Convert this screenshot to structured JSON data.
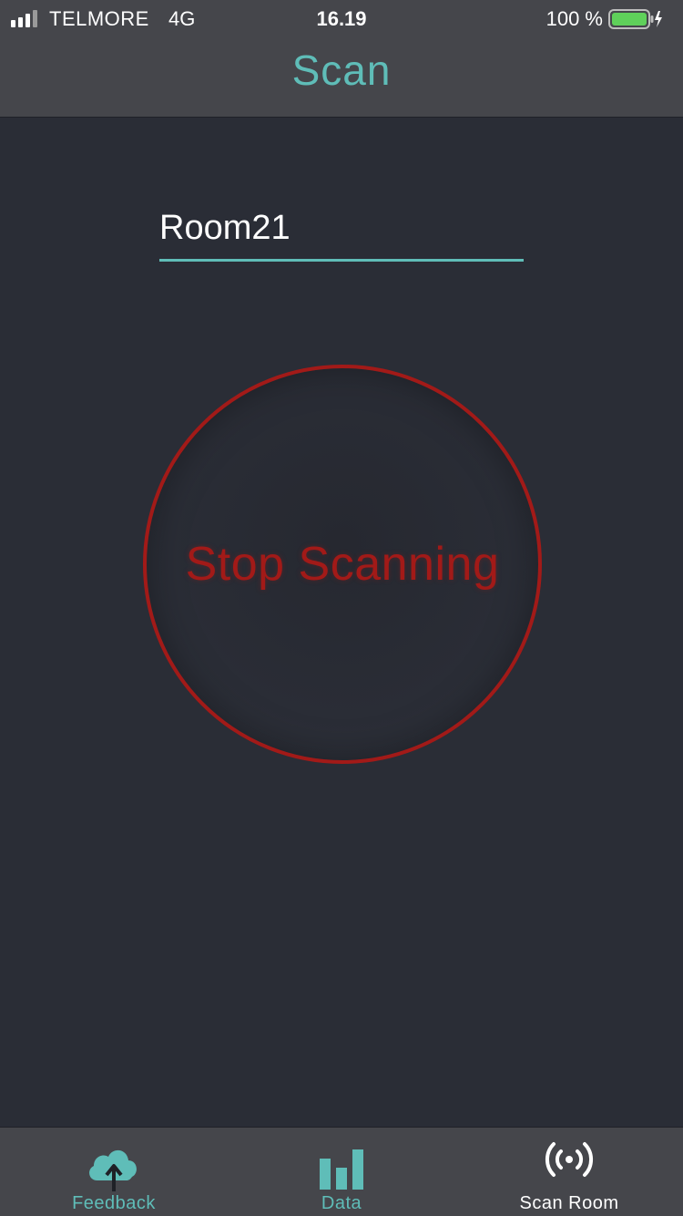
{
  "status_bar": {
    "carrier": "TELMORE",
    "network": "4G",
    "time": "16.19",
    "battery_percent": "100 %",
    "signal_icon": "cellular-signal-icon",
    "battery_icon": "battery-charging-icon"
  },
  "nav": {
    "title": "Scan"
  },
  "room": {
    "value": "Room21"
  },
  "scan_button": {
    "label": "Stop Scanning"
  },
  "tab_bar": {
    "tabs": [
      {
        "label": "Feedback",
        "icon": "cloud-upload-icon",
        "active": false
      },
      {
        "label": "Data",
        "icon": "bar-chart-icon",
        "active": false
      },
      {
        "label": "Scan Room",
        "icon": "broadcast-icon",
        "active": true
      }
    ]
  },
  "colors": {
    "accent": "#5fbdb8",
    "stop_red": "#a21a18",
    "background": "#2a2d36",
    "bar": "#45464b",
    "battery_green": "#5fd05a"
  }
}
